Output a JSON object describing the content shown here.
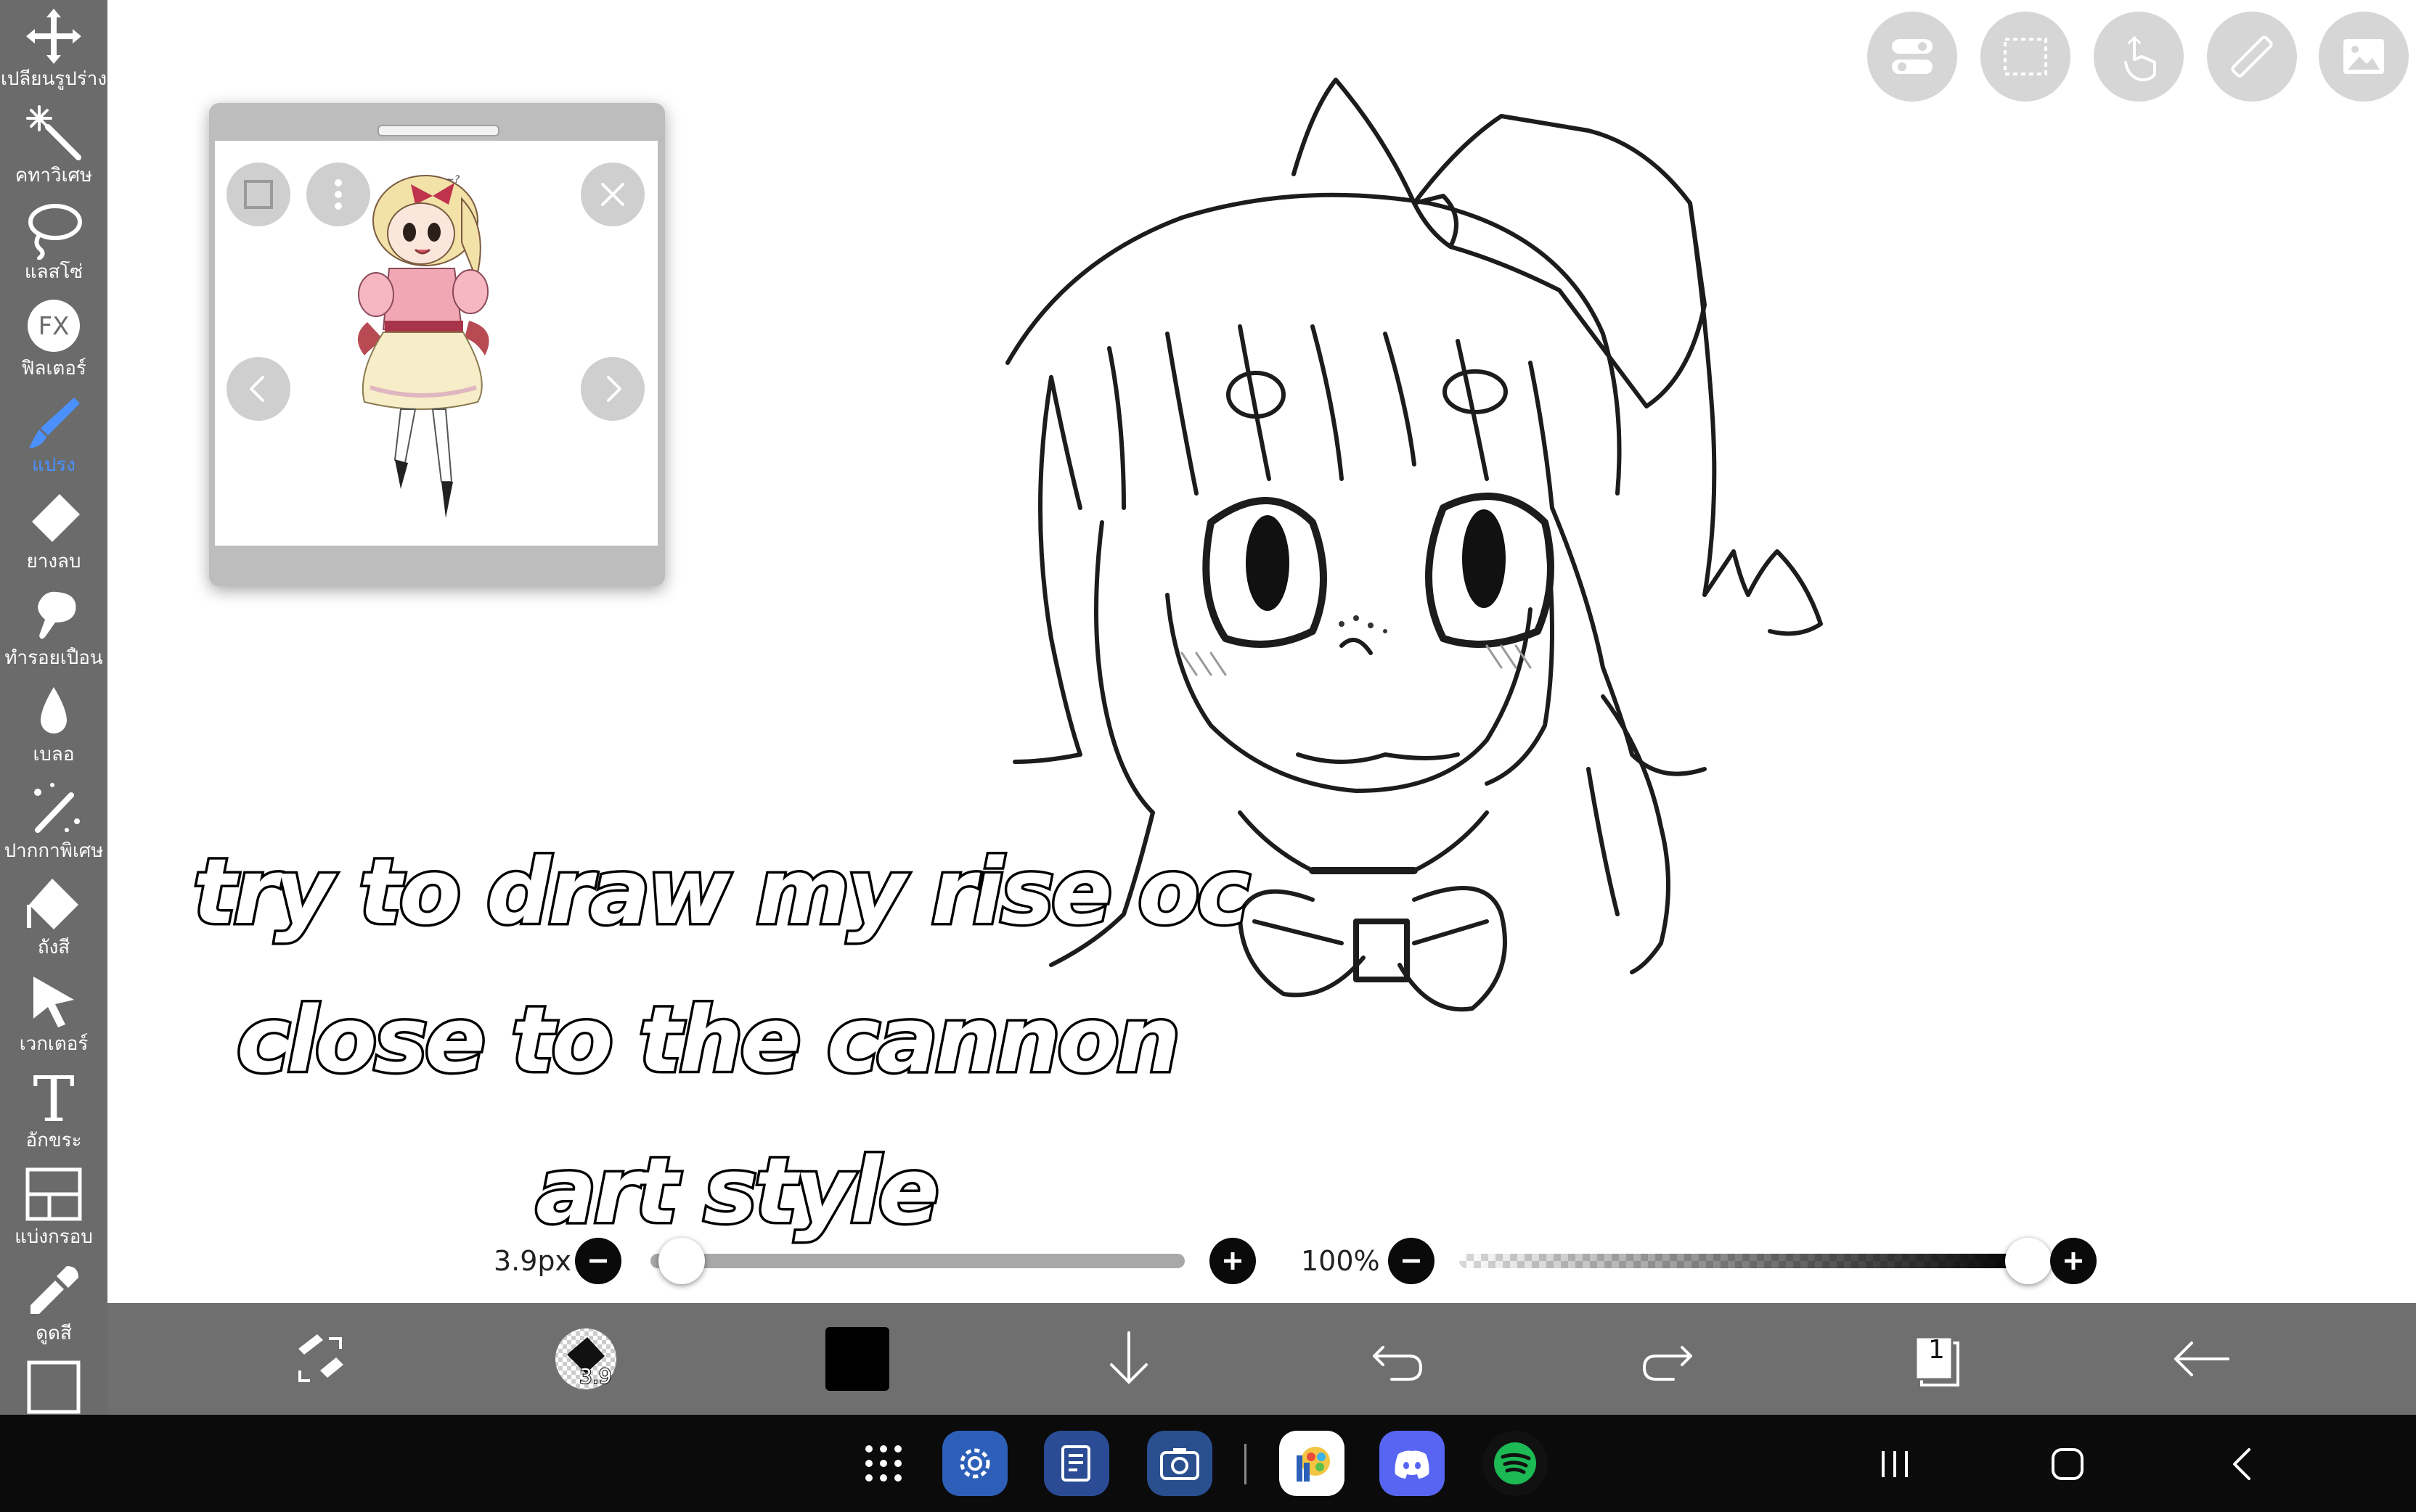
{
  "left_toolbar": {
    "tools": [
      {
        "label": "เปลี่ยนรูปร่าง",
        "icon": "move-icon"
      },
      {
        "label": "คทาวิเศษ",
        "icon": "magic-wand-icon"
      },
      {
        "label": "แลสโซ่",
        "icon": "lasso-icon"
      },
      {
        "label": "ฟิลเตอร์",
        "icon": "fx-icon"
      },
      {
        "label": "แปรง",
        "icon": "brush-icon",
        "active": true
      },
      {
        "label": "ยางลบ",
        "icon": "eraser-icon"
      },
      {
        "label": "ทำรอยเปื้อน",
        "icon": "smudge-icon"
      },
      {
        "label": "เบลอ",
        "icon": "blur-drop-icon"
      },
      {
        "label": "ปากกาพิเศษ",
        "icon": "special-pen-icon"
      },
      {
        "label": "ถังสี",
        "icon": "bucket-icon"
      },
      {
        "label": "เวกเตอร์",
        "icon": "vector-cursor-icon"
      },
      {
        "label": "อักขระ",
        "icon": "text-icon"
      },
      {
        "label": "แบ่งกรอบ",
        "icon": "frame-divider-icon"
      },
      {
        "label": "ดูดสี",
        "icon": "eyedropper-icon"
      },
      {
        "label": "",
        "icon": "canvas-icon"
      }
    ]
  },
  "canvas": {
    "caption_lines": [
      "try to draw my rise oc",
      "close to the cannon",
      "art style"
    ]
  },
  "reference_window": {
    "buttons": [
      "square-icon",
      "more-vertical-icon",
      "close-icon",
      "prev-icon",
      "next-icon"
    ]
  },
  "top_right_buttons": [
    "toggle-icon",
    "selection-icon",
    "touch-icon",
    "ruler-icon",
    "image-icon"
  ],
  "brush_size_slider": {
    "value_label": "3.9px",
    "value": 3.9,
    "fraction": 0.02
  },
  "opacity_slider": {
    "value_label": "100%",
    "value": 100,
    "fraction": 1.0
  },
  "bottom_toolbar": {
    "brush_size_badge": "3.9",
    "layer_count": "1",
    "current_color": "#000000"
  },
  "dock": {
    "apps": [
      "apps-grid-icon",
      "settings-icon",
      "notes-icon",
      "camera-icon",
      "ibispaint-icon",
      "discord-icon",
      "spotify-icon"
    ]
  },
  "colors": {
    "toolbar": "#6b6b6b",
    "active_tool": "#4a90ff",
    "discord": "#5865f2",
    "spotify": "#1db954"
  }
}
